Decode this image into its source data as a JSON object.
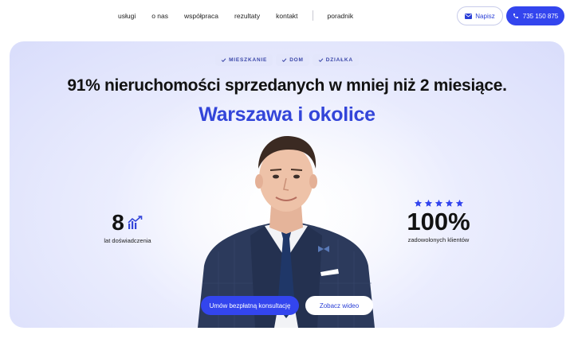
{
  "nav": {
    "links": [
      "usługi",
      "o nas",
      "współpraca",
      "rezultaty",
      "kontakt"
    ],
    "extra_link": "poradnik",
    "write_button": "Napisz",
    "phone_button": "735 150 875"
  },
  "hero": {
    "tags": [
      "MIESZKANIE",
      "DOM",
      "DZIAŁKA"
    ],
    "headline": "91% nieruchomości sprzedanych w mniej niż 2 miesiące.",
    "subline": "Warszawa i okolice",
    "stat_left": {
      "value": "8",
      "label": "lat doświadczenia"
    },
    "stat_right": {
      "value": "100%",
      "label": "zadowolonych klientów",
      "stars": 5
    },
    "cta_primary": "Umów bezpłatną konsultację",
    "cta_secondary": "Zobacz wideo"
  },
  "colors": {
    "accent": "#3345ee",
    "accent_text": "#3345d9",
    "hero_bg": "#dfe2fc"
  },
  "icons": [
    "mail-icon",
    "phone-icon",
    "check-icon",
    "growth-chart-icon",
    "star-icon"
  ]
}
